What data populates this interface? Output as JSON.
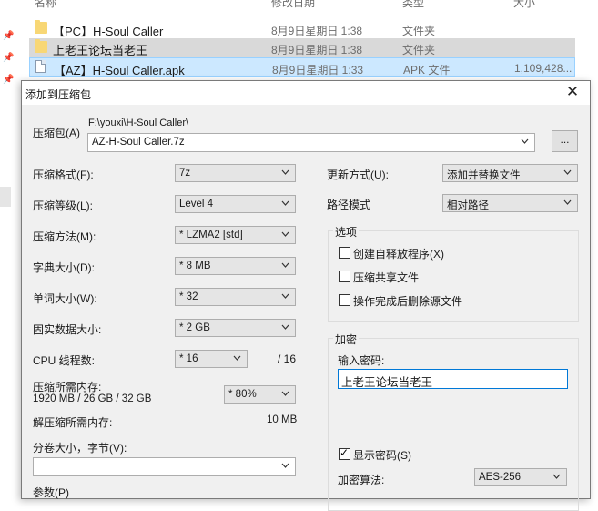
{
  "explorer": {
    "columns": {
      "name": "名称",
      "date": "修改日期",
      "type": "类型",
      "size": "大小"
    },
    "files": [
      {
        "name": "【PC】H-Soul Caller",
        "date": "8月9日星期日 1:38",
        "type": "文件夹",
        "size": "",
        "icon": "folder-icon"
      },
      {
        "name": "上老王论坛当老王",
        "date": "8月9日星期日 1:38",
        "type": "文件夹",
        "size": "",
        "icon": "folder-icon"
      },
      {
        "name": "【AZ】H-Soul Caller.apk",
        "date": "8月9日星期日 1:33",
        "type": "APK 文件",
        "size": "1,109,428...",
        "icon": "apk-file-icon"
      }
    ]
  },
  "dialog": {
    "title": "添加到压缩包",
    "close": "✕",
    "archive_label": "压缩包(A)",
    "archive_path": "F:\\youxi\\H-Soul Caller\\",
    "archive_name": "AZ-H-Soul Caller.7z",
    "browse_label": "...",
    "left": {
      "format_label": "压缩格式(F):",
      "format_value": "7z",
      "level_label": "压缩等级(L):",
      "level_value": "Level 4",
      "method_label": "压缩方法(M):",
      "method_value": "* LZMA2 [std]",
      "dict_label": "字典大小(D):",
      "dict_value": "* 8 MB",
      "word_label": "单词大小(W):",
      "word_value": "* 32",
      "solid_label": "固实数据大小:",
      "solid_value": "* 2 GB",
      "threads_label": "CPU 线程数:",
      "threads_value": "* 16",
      "threads_max": "/ 16",
      "mem_comp_label": "压缩所需内存:",
      "mem_comp_value": "1920 MB / 26 GB / 32 GB",
      "mem_percent": "* 80%",
      "mem_decomp_label": "解压缩所需内存:",
      "mem_decomp_value": "10 MB",
      "split_label": "分卷大小，字节(V):",
      "split_value": "",
      "params_label": "参数(P)"
    },
    "right": {
      "update_label": "更新方式(U):",
      "update_value": "添加并替换文件",
      "path_label": "路径模式",
      "path_value": "相对路径",
      "options_title": "选项",
      "options": [
        {
          "label": "创建自释放程序(X)",
          "checked": false
        },
        {
          "label": "压缩共享文件",
          "checked": false
        },
        {
          "label": "操作完成后删除源文件",
          "checked": false
        }
      ],
      "encryption_title": "加密",
      "password_label": "输入密码:",
      "password_value": "上老王论坛当老王",
      "show_password_label": "显示密码(S)",
      "show_password_checked": true,
      "encrypt_method_label": "加密算法:",
      "encrypt_method_value": "AES-256"
    }
  }
}
